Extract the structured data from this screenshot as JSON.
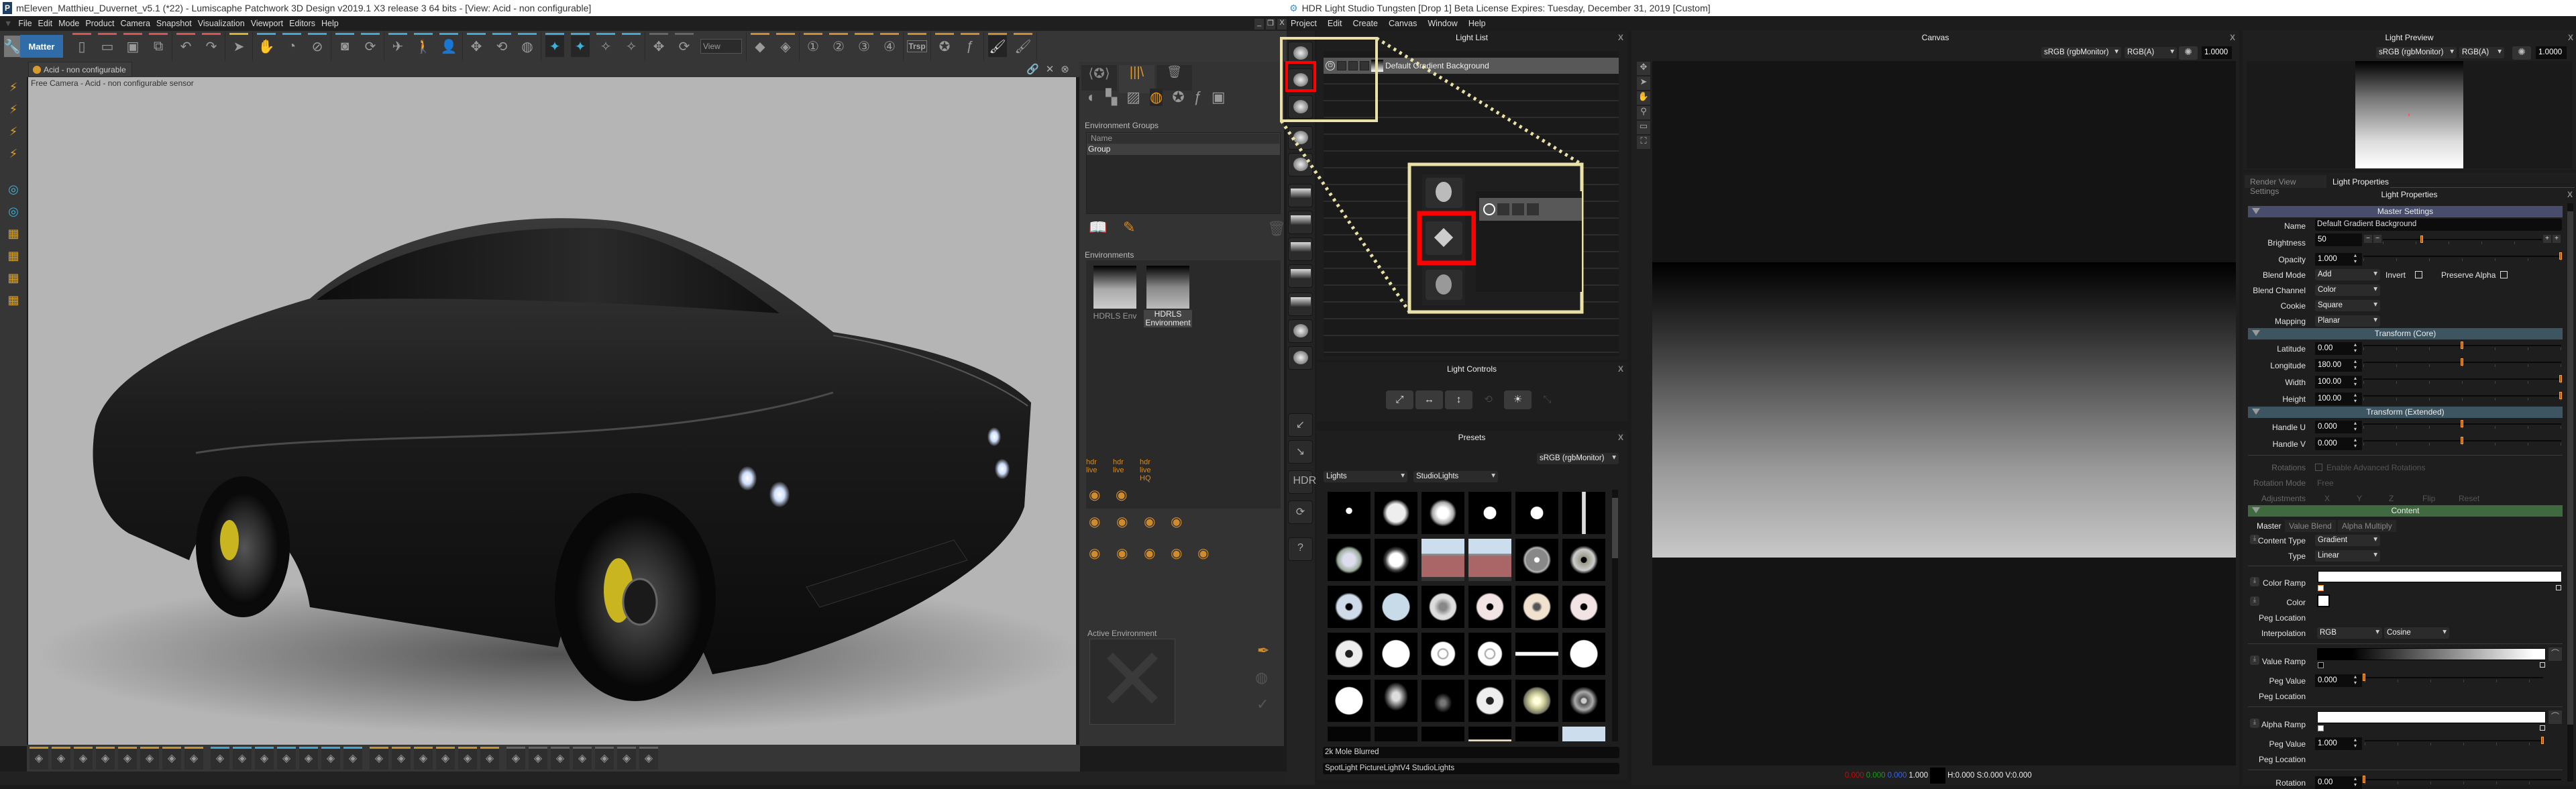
{
  "patchwork": {
    "window_title": "mEleven_Matthieu_Duvernet_v5.1 (*22) - Lumiscaphe Patchwork 3D Design v2019.1 X3 release 3  64 bits - [View: Acid - non configurable]",
    "app_icon_letter": "P",
    "menu": [
      "File",
      "Edit",
      "Mode",
      "Product",
      "Camera",
      "Snapshot",
      "Visualization",
      "Viewport",
      "Editors",
      "Help"
    ],
    "window_controls": [
      "_",
      "❐",
      "X"
    ],
    "matter_button": "Matter",
    "toolbar_groups": [
      {
        "color": "#d9534f",
        "icons": [
          "new-file",
          "open-folder",
          "save",
          "save-as"
        ]
      },
      {
        "color": "#d9534f",
        "icons": [
          "undo",
          "redo"
        ]
      },
      {
        "color": "#d4b22a",
        "icons": [
          "select-arrow"
        ]
      },
      {
        "color": "#3fa9d6",
        "icons": [
          "pan-hand",
          "orbit",
          "zoom-camera"
        ]
      },
      {
        "color": "#3fa9d6",
        "icons": [
          "camera",
          "rotate-camera"
        ]
      },
      {
        "color": "#3fa9d6",
        "icons": [
          "fly",
          "walk",
          "user"
        ]
      },
      {
        "color": "#3fa9d6",
        "icons": [
          "move",
          "rotate",
          "globe-rotate"
        ]
      },
      {
        "color": "#3fa9d6",
        "icons": [
          "effect-a",
          "effect-b",
          "effect-c",
          "effect-d"
        ]
      },
      {
        "color": "#666666",
        "icons": [
          "move-gray",
          "rotate-gray"
        ]
      },
      {
        "color": "#d08b2c",
        "icons": [
          "shape-a",
          "shape-b"
        ]
      },
      {
        "color": "#d08b2c",
        "icons": [
          "camera-1",
          "camera-2",
          "camera-3",
          "camera-4"
        ]
      },
      {
        "color": "#d08b2c",
        "icons": [
          "transparency"
        ]
      },
      {
        "color": "#d08b2c",
        "icons": [
          "star-effect",
          "fx"
        ]
      },
      {
        "color": "#d08b2c",
        "icons": [
          "paint-brush",
          "paint-brush-2"
        ]
      }
    ],
    "view_dropdown": "View",
    "camera_labels": [
      "1",
      "2",
      "3",
      "4"
    ],
    "trsp_label": "Trsp",
    "view_tab": "Acid - non configurable",
    "viewport_caption": "Free Camera - Acid - non configurable sensor",
    "viewport_bg": "#b4b5b4",
    "caliper_color": "#c8b520",
    "side_panel": {
      "environment_groups_title": "Environment Groups",
      "column_header": "Name",
      "groups": [
        "Group"
      ],
      "environments_title": "Environments",
      "environments": [
        {
          "label": "HDRLS Env",
          "selected": false
        },
        {
          "label": "HDRLS Environment",
          "selected": true
        }
      ],
      "hdr_live_labels": [
        "hdr live",
        "hdr live",
        "hdr live HQ"
      ],
      "active_environment_title": "Active Environment"
    },
    "bottom_toolbar_icons": [
      "render",
      "snapshot",
      "snapshot-settings",
      "video-camera",
      "light",
      "clapper",
      "joystick",
      "plus-grid",
      "material-a",
      "location",
      "globe-a",
      "globe-b",
      "check-list",
      "tools-list",
      "list",
      "disc",
      "image",
      "globe",
      "star",
      "fx",
      "film",
      "ruler",
      "measure",
      "glasses",
      "tag",
      "ring",
      "target",
      "chart"
    ]
  },
  "hdrls": {
    "window_title": "HDR Light Studio Tungsten [Drop 1] Beta License Expires: Tuesday, December 31, 2019  [Custom]",
    "menu": [
      "Project",
      "Edit",
      "Create",
      "Canvas",
      "Window",
      "Help"
    ],
    "light_list": {
      "title": "Light List",
      "lights": [
        {
          "name": "Default Gradient Background",
          "enabled": true
        }
      ]
    },
    "light_controls": {
      "title": "Light Controls",
      "buttons": [
        "scale",
        "move-horizontal",
        "move-vertical",
        "rotate",
        "brightness",
        "stretch"
      ]
    },
    "presets": {
      "title": "Presets",
      "color_space": "sRGB (rgbMonitor)",
      "category": "Lights",
      "subcategory": "StudioLights",
      "selected_name": "2k Mole Blurred",
      "selected_tags": "SpotLight PictureLightV4 StudioLights",
      "thumbnails": [
        "spot",
        "glow",
        "soft",
        "dot",
        "dot",
        "strip",
        "fresnel",
        "box",
        "window",
        "window",
        "ring",
        "ring-dark",
        "beauty",
        "disc-blue",
        "disc-grey",
        "beauty-pink",
        "beauty-warm",
        "beauty-pink",
        "beauty-dark",
        "disc-white",
        "ring-white",
        "ring-white",
        "bar",
        "disc-white",
        "disc-white",
        "dome",
        "dome-dim",
        "beauty-dark",
        "sun",
        "ring-grey",
        "dark",
        "dark",
        "panel",
        "panel-warm",
        "arc",
        "window"
      ]
    },
    "canvas": {
      "title": "Canvas",
      "color_space": "sRGB (rgbMonitor)",
      "channel": "RGB(A)",
      "exposure": "1.0000",
      "status": {
        "r": "0.000",
        "g": "0.000",
        "b": "0.000",
        "a": "1.000",
        "hsv": "H:0.000 S:0.000 V:0.000"
      }
    },
    "light_preview": {
      "title": "Light Preview",
      "color_space": "sRGB (rgbMonitor)",
      "channel": "RGB(A)",
      "exposure": "1.0000"
    },
    "properties": {
      "tabs": [
        "Render View Settings",
        "Light Properties"
      ],
      "active_tab": "Light Properties",
      "title": "Light Properties",
      "master": {
        "header": "Master Settings",
        "name_label": "Name",
        "name": "Default Gradient Background",
        "brightness_label": "Brightness",
        "brightness": "50",
        "brightness_slider": 0.25,
        "opacity_label": "Opacity",
        "opacity": "1.000",
        "opacity_slider": 1.0,
        "blend_mode_label": "Blend Mode",
        "blend_mode": "Add",
        "invert_label": "Invert",
        "invert": false,
        "preserve_alpha_label": "Preserve Alpha",
        "preserve_alpha": false,
        "blend_channel_label": "Blend Channel",
        "blend_channel": "Color",
        "cookie_label": "Cookie",
        "cookie": "Square",
        "mapping_label": "Mapping",
        "mapping": "Planar"
      },
      "transform_core": {
        "header": "Transform (Core)",
        "rows": [
          {
            "label": "Latitude",
            "value": "0.00",
            "slider": 0.5
          },
          {
            "label": "Longitude",
            "value": "180.00",
            "slider": 0.5
          },
          {
            "label": "Width",
            "value": "100.00",
            "slider": 1.0
          },
          {
            "label": "Height",
            "value": "100.00",
            "slider": 1.0
          }
        ]
      },
      "transform_extended": {
        "header": "Transform (Extended)",
        "rows": [
          {
            "label": "Handle U",
            "value": "0.000",
            "slider": 0.5
          },
          {
            "label": "Handle V",
            "value": "0.000",
            "slider": 0.5
          }
        ],
        "rotations_label": "Rotations",
        "enable_advanced": "Enable Advanced Rotations",
        "rotation_mode_label": "Rotation Mode",
        "rotation_mode": "Free",
        "adjustments_label": "Adjustments",
        "adjust_axes": [
          "X",
          "Y",
          "Z"
        ],
        "flip": "Flip",
        "reset": "Reset"
      },
      "content": {
        "header": "Content",
        "tabs": [
          "Master",
          "Value Blend",
          "Alpha Multiply"
        ],
        "content_type_label": "Content Type",
        "content_type": "Gradient",
        "type_label": "Type",
        "type": "Linear",
        "color_ramp_label": "Color Ramp",
        "color_label": "Color",
        "color": "#ffffff",
        "peg_location_label": "Peg Location",
        "interpolation_label": "Interpolation",
        "interpolation": "RGB",
        "interpolation_curve": "Cosine",
        "value_ramp_label": "Value Ramp",
        "peg_value_label": "Peg Value",
        "value_peg": "0.000",
        "value_peg_slider": 0.0,
        "alpha_ramp_label": "Alpha Ramp",
        "alpha_peg": "1.000",
        "alpha_peg_slider": 1.0,
        "rotation_label": "Rotation",
        "rotation": "0.00",
        "rotation_slider": 0.0
      }
    },
    "accent": "#c45e00",
    "callout_color": "#e9e1a6",
    "highlight_color": "#ff0000"
  }
}
